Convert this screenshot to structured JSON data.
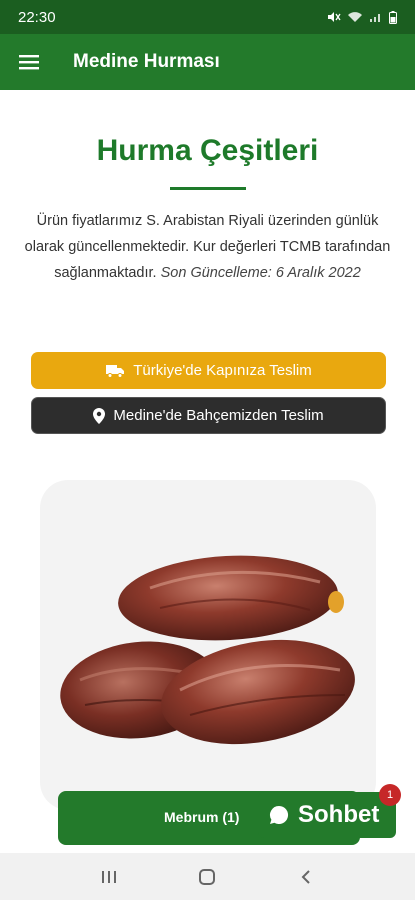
{
  "status": {
    "time": "22:30"
  },
  "app": {
    "title": "Medine Hurması"
  },
  "page": {
    "title": "Hurma Çeşitleri",
    "description_text": "Ürün fiyatlarımız S. Arabistan Riyali üzerinden günlük olarak güncellenmektedir. Kur değerleri TCMB tarafından sağlanmaktadır.",
    "last_updated": "Son Güncelleme: 6 Aralık 2022"
  },
  "buttons": {
    "turkey_delivery": "Türkiye'de Kapınıza Teslim",
    "medina_delivery": "Medine'de Bahçemizden Teslim"
  },
  "product": {
    "image_icon": "dates-image"
  },
  "cart": {
    "label": "Mebrum (1)"
  },
  "chat": {
    "label": "Sohbet",
    "badge": "1"
  },
  "colors": {
    "primary": "#237a2b",
    "accent": "#e9a80f",
    "dark": "#2d2d2d",
    "badge": "#c62828"
  },
  "icons": {
    "menu": "hamburger-menu-icon",
    "truck": "truck-icon",
    "pin": "location-pin-icon",
    "chat": "chat-bubble-icon"
  }
}
